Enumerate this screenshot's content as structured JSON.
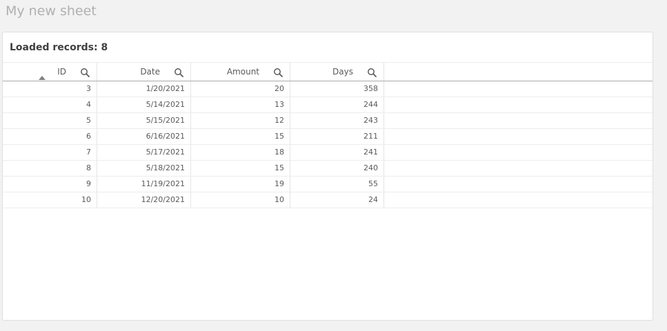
{
  "sheet": {
    "title": "My new sheet"
  },
  "table_card": {
    "title": "Loaded records: 8",
    "columns": [
      {
        "label": "ID",
        "icon": "search-icon"
      },
      {
        "label": "Date",
        "icon": "search-icon"
      },
      {
        "label": "Amount",
        "icon": "search-icon"
      },
      {
        "label": "Days",
        "icon": "search-icon"
      }
    ],
    "sort": {
      "column": "ID",
      "direction": "ascending",
      "icon": "sort-ascending-icon"
    },
    "rows": [
      [
        "3",
        "1/20/2021",
        "20",
        "358"
      ],
      [
        "4",
        "5/14/2021",
        "13",
        "244"
      ],
      [
        "5",
        "5/15/2021",
        "12",
        "243"
      ],
      [
        "6",
        "6/16/2021",
        "15",
        "211"
      ],
      [
        "7",
        "5/17/2021",
        "18",
        "241"
      ],
      [
        "8",
        "5/18/2021",
        "15",
        "240"
      ],
      [
        "9",
        "11/19/2021",
        "19",
        "55"
      ],
      [
        "10",
        "12/20/2021",
        "10",
        "24"
      ]
    ]
  },
  "colors": {
    "background": "#f2f2f2",
    "card": "#ffffff",
    "title_gray": "#b0b0b0",
    "text": "#595959"
  }
}
